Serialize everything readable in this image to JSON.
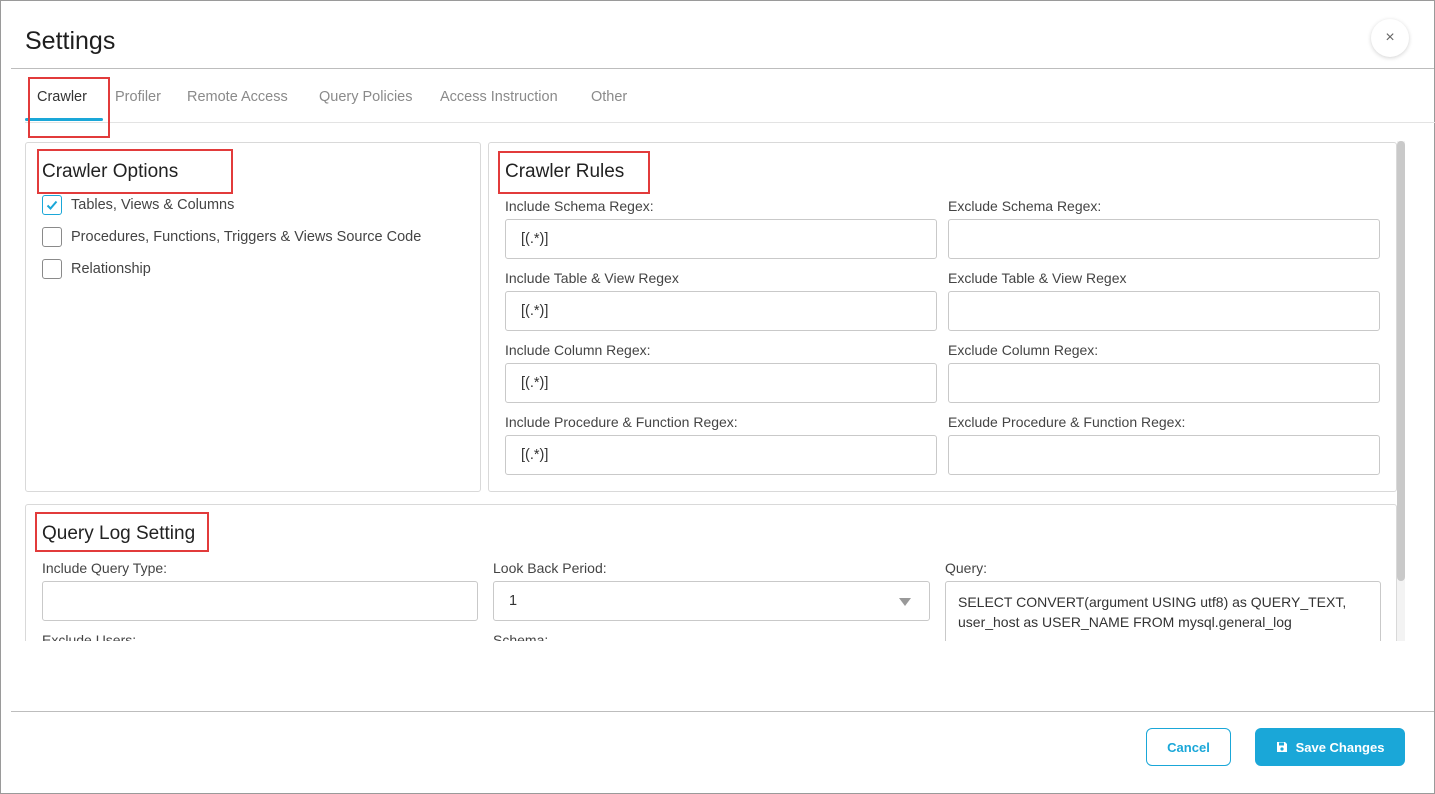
{
  "dialog": {
    "title": "Settings",
    "close_glyph": "×"
  },
  "tabs": [
    {
      "label": "Crawler",
      "active": true
    },
    {
      "label": "Profiler"
    },
    {
      "label": "Remote Access"
    },
    {
      "label": "Query Policies"
    },
    {
      "label": "Access Instruction"
    },
    {
      "label": "Other"
    }
  ],
  "crawler_options": {
    "title": "Crawler Options",
    "items": [
      {
        "label": "Tables, Views & Columns",
        "checked": true
      },
      {
        "label": "Procedures, Functions, Triggers & Views Source Code",
        "checked": false
      },
      {
        "label": "Relationship",
        "checked": false
      }
    ]
  },
  "crawler_rules": {
    "title": "Crawler Rules",
    "include_schema": {
      "label": "Include Schema Regex:",
      "value": "[(.*)]"
    },
    "exclude_schema": {
      "label": "Exclude Schema Regex:",
      "value": ""
    },
    "include_table": {
      "label": "Include Table & View Regex",
      "value": "[(.*)]"
    },
    "exclude_table": {
      "label": "Exclude Table & View Regex",
      "value": ""
    },
    "include_column": {
      "label": "Include Column Regex:",
      "value": "[(.*)]"
    },
    "exclude_column": {
      "label": "Exclude Column Regex:",
      "value": ""
    },
    "include_procedure": {
      "label": "Include Procedure & Function Regex:",
      "value": "[(.*)]"
    },
    "exclude_procedure": {
      "label": "Exclude Procedure & Function Regex:",
      "value": ""
    }
  },
  "query_log": {
    "title": "Query Log Setting",
    "include_query_type": {
      "label": "Include Query Type:",
      "value": ""
    },
    "look_back_period": {
      "label": "Look Back Period:",
      "value": "1"
    },
    "query": {
      "label": "Query:",
      "value": "SELECT CONVERT(argument USING utf8) as QUERY_TEXT, user_host as USER_NAME FROM mysql.general_log"
    },
    "exclude_users": {
      "label": "Exclude Users:"
    },
    "schema": {
      "label": "Schema:"
    }
  },
  "footer": {
    "cancel_label": "Cancel",
    "save_label": "Save Changes"
  },
  "colors": {
    "accent": "#1aa7d8",
    "highlight": "#e23b3b"
  }
}
